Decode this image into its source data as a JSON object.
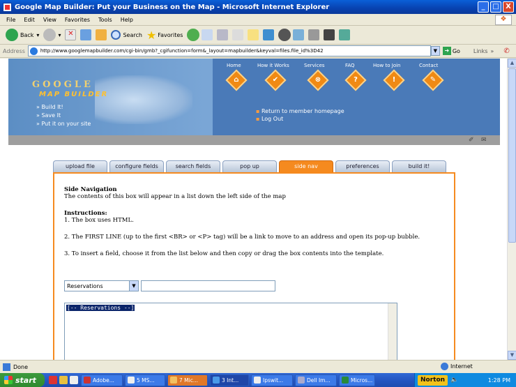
{
  "window": {
    "title": "Google Map Builder: Put your Business on the Map - Microsoft Internet Explorer",
    "controls": [
      "_",
      "□",
      "X"
    ]
  },
  "menu": [
    "File",
    "Edit",
    "View",
    "Favorites",
    "Tools",
    "Help"
  ],
  "toolbar": {
    "back": "Back",
    "search": "Search",
    "favorites": "Favorites"
  },
  "address": {
    "label": "Address",
    "url": "http://www.googlemapbuilder.com/cgi-bin/gmb?_cgifunction=form&_layout=mapbuilder&keyval=files.file_id%3D42",
    "go": "Go",
    "links": "Links"
  },
  "site": {
    "logo_line1": "GOOGLE",
    "logo_line2": "MAP BUILDER",
    "taglines": [
      "Build It!",
      "Save It",
      "Put it on your site"
    ],
    "nav": [
      "Home",
      "How it Works",
      "Services",
      "FAQ",
      "How to Join",
      "Contact"
    ],
    "nav_icons": [
      "⌂",
      "✔",
      "⊗",
      "?",
      "!",
      "✎"
    ],
    "member_links": [
      "Return to member homepage",
      "Log Out"
    ],
    "strip_icons": [
      "✐",
      "✉"
    ]
  },
  "tabs": [
    "upload file",
    "configure fields",
    "search fields",
    "pop up",
    "side nav",
    "preferences",
    "build it!"
  ],
  "active_tab": "side nav",
  "panel": {
    "heading": "Side Navigation",
    "intro": "The contents of this box will appear in a list down the left side of the map",
    "instructions_heading": "Instructions:",
    "step1": "1. The box uses HTML.",
    "step2": "2. The FIRST LINE (up to the first <BR> or <P> tag) will be a link to move to an address and open its pop-up bubble.",
    "step3": "3. To insert a field, choose it from the list below and then copy or drag the box contents into the template.",
    "select_value": "Reservations",
    "field_value": "",
    "textarea_selected": "[-- Reservations --]"
  },
  "status": {
    "text": "Done",
    "zone": "Internet"
  },
  "taskbar": {
    "start": "start",
    "buttons": [
      "Adobe...",
      "5 MS...",
      "7 Mic...",
      "3 Int...",
      "Ipswit...",
      "Dell Im...",
      "Micros..."
    ],
    "norton": "Norton",
    "clock": "1:28 PM"
  },
  "colors": {
    "accent": "#f58a1f",
    "title_bar": "#0842b0",
    "header_blue": "#5c8ec4"
  }
}
